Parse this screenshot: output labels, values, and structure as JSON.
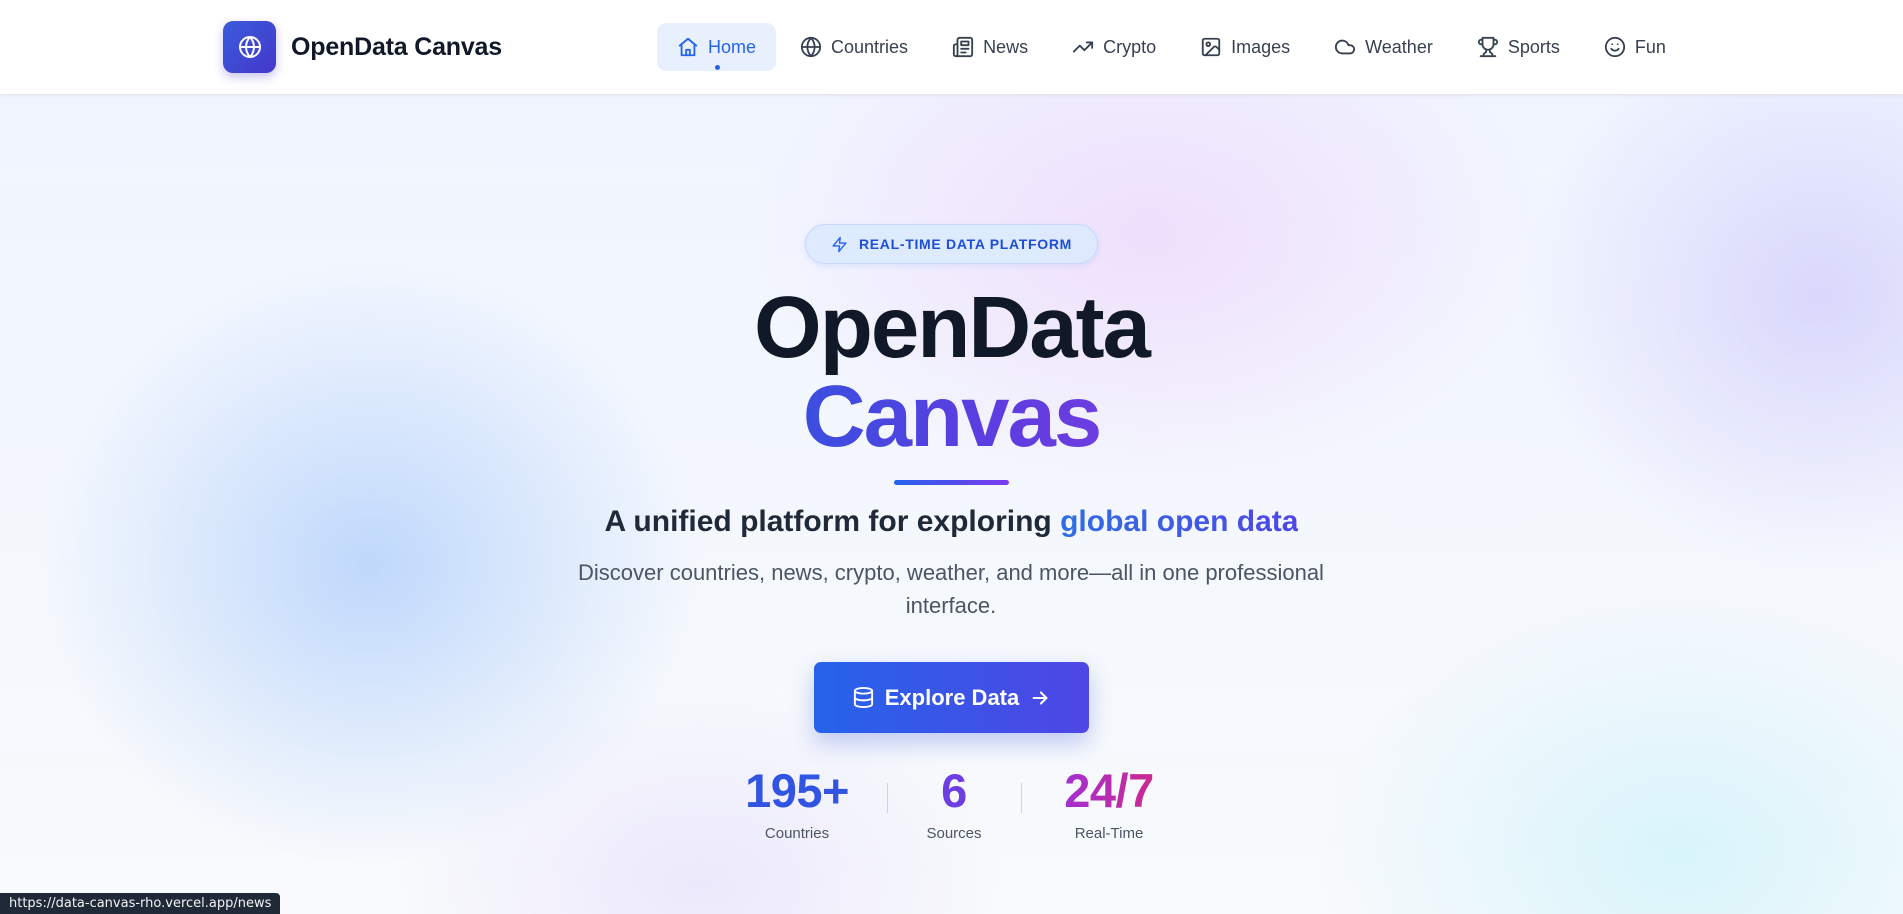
{
  "brand": {
    "name": "OpenData Canvas",
    "icon": "globe-icon",
    "color": "#3b5bdb"
  },
  "nav": {
    "items": [
      {
        "label": "Home",
        "icon": "home-icon",
        "active": true
      },
      {
        "label": "Countries",
        "icon": "globe-icon",
        "active": false
      },
      {
        "label": "News",
        "icon": "newspaper-icon",
        "active": false
      },
      {
        "label": "Crypto",
        "icon": "trending-up-icon",
        "active": false
      },
      {
        "label": "Images",
        "icon": "image-icon",
        "active": false
      },
      {
        "label": "Weather",
        "icon": "cloud-icon",
        "active": false
      },
      {
        "label": "Sports",
        "icon": "trophy-icon",
        "active": false
      },
      {
        "label": "Fun",
        "icon": "smile-icon",
        "active": false
      }
    ],
    "active_color": "#2563eb"
  },
  "hero": {
    "badge": {
      "icon": "zap-icon",
      "label": "REAL-TIME DATA PLATFORM"
    },
    "title_line1": "OpenData",
    "title_line2": "Canvas",
    "tagline_prefix": "A unified platform for exploring ",
    "tagline_accent": "global open data",
    "subtitle": "Discover countries, news, crypto, weather, and more—all in one professional interface.",
    "cta": {
      "label": "Explore Data",
      "icon_left": "database-icon",
      "icon_right": "arrow-right-icon"
    },
    "stats": [
      {
        "value": "195+",
        "label": "Countries",
        "color": "#3154e3"
      },
      {
        "value": "6",
        "label": "Sources",
        "color": "#6d3fe2"
      },
      {
        "value": "24/7",
        "label": "Real-Time",
        "color": "#c026d3"
      }
    ]
  },
  "status_bar": {
    "url": "https://data-canvas-rho.vercel.app/news"
  }
}
